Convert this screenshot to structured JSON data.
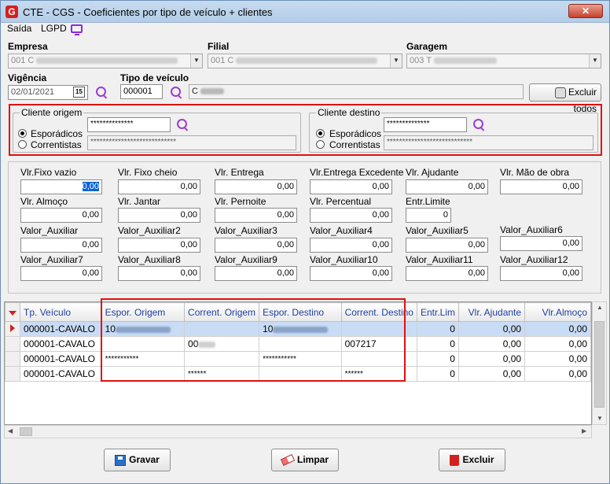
{
  "window": {
    "title": "CTE - CGS - Coeficientes por tipo de veículo + clientes",
    "close_label": "✕",
    "app_icon_letter": "G"
  },
  "menu": {
    "saida": "Saída",
    "lgpd": "LGPD"
  },
  "header": {
    "empresa_label": "Empresa",
    "empresa_value": "001 C",
    "filial_label": "Filial",
    "filial_value": "001 C",
    "garagem_label": "Garagem",
    "garagem_value": "003 T",
    "vigencia_label": "Vigência",
    "vigencia_value": "02/01/2021",
    "calendar_label": "15",
    "tipo_label": "Tipo de veículo",
    "tipo_code": "000001",
    "tipo_desc": "C",
    "excluir_todos": "Excluir todos"
  },
  "cliente_origem": {
    "title": "Cliente origem",
    "option1": "Esporádicos",
    "option2": "Correntistas",
    "code": "**************",
    "name": "****************************"
  },
  "cliente_destino": {
    "title": "Cliente destino",
    "option1": "Esporádicos",
    "option2": "Correntistas",
    "code": "**************",
    "name": "****************************"
  },
  "fields": [
    {
      "label": "Vlr.Fixo vazio",
      "value": "0,00"
    },
    {
      "label": "Vlr. Fixo cheio",
      "value": "0,00"
    },
    {
      "label": "Vlr. Entrega",
      "value": "0,00"
    },
    {
      "label": "Vlr.Entrega Excedente",
      "value": "0,00"
    },
    {
      "label": "Vlr. Ajudante",
      "value": "0,00"
    },
    {
      "label": "Vlr. Mão de obra",
      "value": "0,00"
    },
    {
      "label": "Vlr. Almoço",
      "value": "0,00"
    },
    {
      "label": "Vlr. Jantar",
      "value": "0,00"
    },
    {
      "label": "Vlr. Pernoite",
      "value": "0,00"
    },
    {
      "label": "Vlr. Percentual",
      "value": "0,00"
    },
    {
      "label": "Entr.Limite",
      "value": "0"
    },
    {
      "label": "Valor_Auxiliar",
      "value": "0,00"
    },
    {
      "label": "Valor_Auxiliar2",
      "value": "0,00"
    },
    {
      "label": "Valor_Auxiliar3",
      "value": "0,00"
    },
    {
      "label": "Valor_Auxiliar4",
      "value": "0,00"
    },
    {
      "label": "Valor_Auxiliar5",
      "value": "0,00"
    },
    {
      "label": "Valor_Auxiliar6",
      "value": "0,00"
    },
    {
      "label": "Valor_Auxiliar7",
      "value": "0,00"
    },
    {
      "label": "Valor_Auxiliar8",
      "value": "0,00"
    },
    {
      "label": "Valor_Auxiliar9",
      "value": "0,00"
    },
    {
      "label": "Valor_Auxiliar10",
      "value": "0,00"
    },
    {
      "label": "Valor_Auxiliar11",
      "value": "0,00"
    },
    {
      "label": "Valor_Auxiliar12",
      "value": "0,00"
    }
  ],
  "grid": {
    "columns": [
      "Tp. Veículo",
      "Espor. Origem",
      "Corrent. Origem",
      "Espor. Destino",
      "Corrent. Destino",
      "Entr.Lim",
      "Vlr. Ajudante",
      "Vlr.Almoço"
    ],
    "rows": [
      {
        "tp": "000001-CAVALO",
        "esp_orig": "10",
        "cor_orig": "",
        "esp_dest": "10",
        "cor_dest": "",
        "entr": "0",
        "ajud": "0,00",
        "almoco": "0,00"
      },
      {
        "tp": "000001-CAVALO",
        "esp_orig": "",
        "cor_orig": "00",
        "esp_dest": "",
        "cor_dest": "007217",
        "entr": "0",
        "ajud": "0,00",
        "almoco": "0,00"
      },
      {
        "tp": "000001-CAVALO",
        "esp_orig": "***********",
        "cor_orig": "",
        "esp_dest": "***********",
        "cor_dest": "",
        "entr": "0",
        "ajud": "0,00",
        "almoco": "0,00"
      },
      {
        "tp": "000001-CAVALO",
        "esp_orig": "",
        "cor_orig": "******",
        "esp_dest": "",
        "cor_dest": "******",
        "entr": "0",
        "ajud": "0,00",
        "almoco": "0,00"
      }
    ]
  },
  "buttons": {
    "gravar": "Gravar",
    "limpar": "Limpar",
    "excluir": "Excluir"
  }
}
